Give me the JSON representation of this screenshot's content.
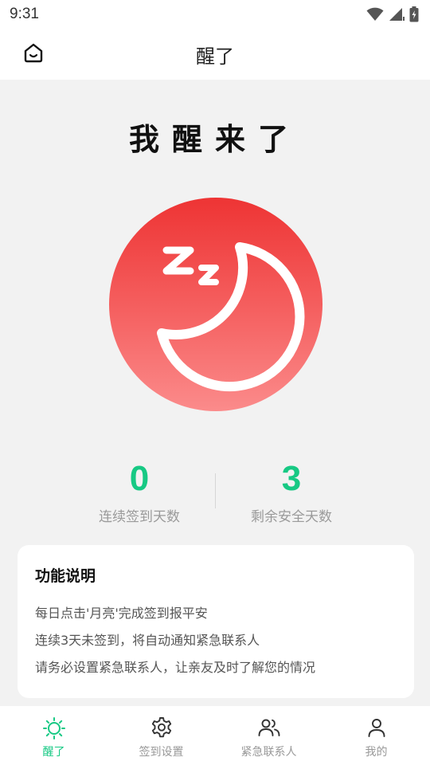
{
  "status_bar": {
    "time": "9:31",
    "icons": [
      "wifi-icon",
      "signal-icon",
      "battery-icon"
    ]
  },
  "app_bar": {
    "title": "醒了",
    "home_icon": "home-icon"
  },
  "main": {
    "headline": "我醒来了",
    "moon_button_icon": "sleeping-moon-icon",
    "stats": [
      {
        "value": "0",
        "label": "连续签到天数"
      },
      {
        "value": "3",
        "label": "剩余安全天数"
      }
    ]
  },
  "info_card": {
    "title": "功能说明",
    "lines": [
      "每日点击'月亮'完成签到报平安",
      "连续3天未签到，将自动通知紧急联系人",
      "请务必设置紧急联系人，让亲友及时了解您的情况"
    ]
  },
  "tab_bar": {
    "tabs": [
      {
        "label": "醒了",
        "icon": "sun-icon",
        "active": true
      },
      {
        "label": "签到设置",
        "icon": "gear-icon",
        "active": false
      },
      {
        "label": "紧急联系人",
        "icon": "contacts-icon",
        "active": false
      },
      {
        "label": "我的",
        "icon": "person-icon",
        "active": false
      }
    ]
  },
  "colors": {
    "accent": "#17c984",
    "moon_gradient_top": "#ee3434",
    "moon_gradient_bottom": "#fb8b8b",
    "background": "#f2f2f2"
  }
}
